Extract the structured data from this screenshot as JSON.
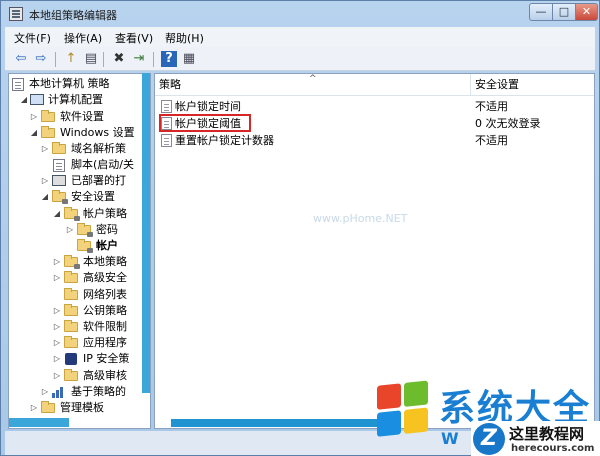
{
  "window": {
    "title": "本地组策略编辑器",
    "controls": {
      "minimize": "—",
      "maximize": "□",
      "close": "✕"
    }
  },
  "menu": [
    {
      "label": "文件(F)"
    },
    {
      "label": "操作(A)"
    },
    {
      "label": "查看(V)"
    },
    {
      "label": "帮助(H)"
    }
  ],
  "toolbar": {
    "back": "⇦",
    "forward": "⇨",
    "up": "↑",
    "show_hide": "▤",
    "delete": "✖",
    "export": "⇥",
    "help": "?",
    "properties": "▦"
  },
  "tree": [
    {
      "label": "本地计算机 策略",
      "level": 0,
      "icon": "doc-icon"
    },
    {
      "label": "计算机配置",
      "level": 1,
      "icon": "computer-icon"
    },
    {
      "label": "软件设置",
      "level": 2,
      "icon": "folder-icon"
    },
    {
      "label": "Windows 设置",
      "level": 2,
      "icon": "folder-icon"
    },
    {
      "label": "域名解析策",
      "level": 3,
      "icon": "folder-icon"
    },
    {
      "label": "脚本(启动/关",
      "level": 3,
      "icon": "doc-icon"
    },
    {
      "label": "已部署的打",
      "level": 3,
      "icon": "printer-icon"
    },
    {
      "label": "安全设置",
      "level": 3,
      "icon": "shield-folder-icon"
    },
    {
      "label": "帐户策略",
      "level": 4,
      "icon": "lock-folder-icon"
    },
    {
      "label": "密码",
      "level": 5,
      "icon": "lock-folder-icon"
    },
    {
      "label": "帐户",
      "level": 5,
      "icon": "lock-folder-icon",
      "selected": true
    },
    {
      "label": "本地策略",
      "level": 4,
      "icon": "lock-folder-icon"
    },
    {
      "label": "高级安全",
      "level": 4,
      "icon": "folder-icon"
    },
    {
      "label": "网络列表",
      "level": 4,
      "icon": "folder-icon"
    },
    {
      "label": "公钥策略",
      "level": 4,
      "icon": "folder-icon"
    },
    {
      "label": "软件限制",
      "level": 4,
      "icon": "folder-icon"
    },
    {
      "label": "应用程序",
      "level": 4,
      "icon": "folder-icon"
    },
    {
      "label": "IP 安全策",
      "level": 4,
      "icon": "ip-security-icon"
    },
    {
      "label": "高级审核",
      "level": 4,
      "icon": "folder-icon"
    },
    {
      "label": "基于策略的",
      "level": 3,
      "icon": "chart-icon"
    },
    {
      "label": "管理模板",
      "level": 2,
      "icon": "folder-icon"
    }
  ],
  "list": {
    "columns": {
      "policy": "策略",
      "setting": "安全设置"
    },
    "rows": [
      {
        "name": "帐户锁定时间",
        "value": "不适用"
      },
      {
        "name": "帐户锁定阈值",
        "value": "0 次无效登录",
        "highlighted": true
      },
      {
        "name": "重置帐户锁定计数器",
        "value": "不适用"
      }
    ]
  },
  "watermark": "www.pHome.NET",
  "branding": {
    "logo_text": "系统大全",
    "logo_sub": "W",
    "badge_letter": "Z",
    "badge_title": "这里教程网",
    "badge_url": "herecours.com"
  },
  "colors": {
    "titlebar": "#b8d3ee",
    "highlight_box": "#d62626",
    "scroll_accent": "#3aa6da",
    "brand_blue": "#1a7fd2"
  }
}
